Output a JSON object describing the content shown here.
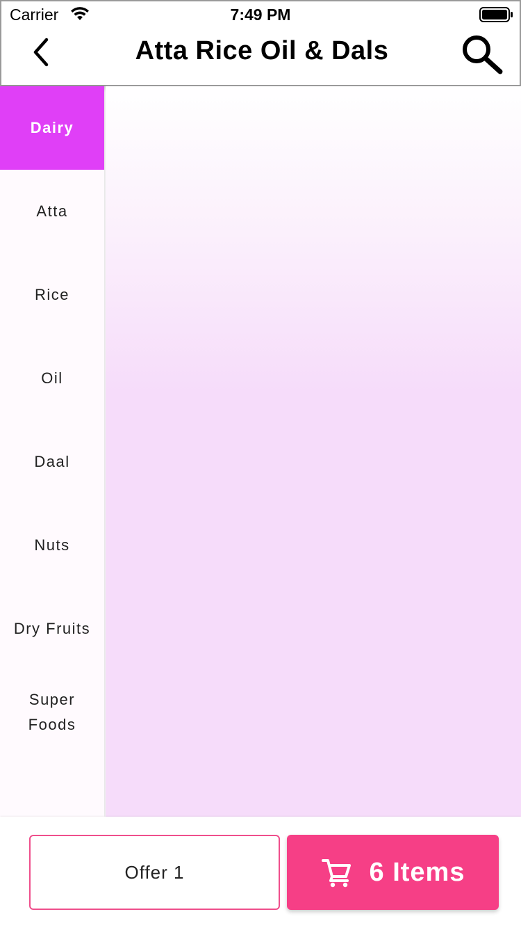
{
  "status_bar": {
    "carrier": "Carrier",
    "time": "7:49 PM",
    "icons": [
      "wifi-icon",
      "battery-icon"
    ]
  },
  "nav": {
    "title": "Atta Rice Oil & Dals",
    "back_icon": "chevron-left-icon",
    "search_icon": "search-icon"
  },
  "sidebar": {
    "active_color": "#e03ff7",
    "items": [
      {
        "label": "Dairy",
        "active": true
      },
      {
        "label": "Atta",
        "active": false
      },
      {
        "label": "Rice",
        "active": false
      },
      {
        "label": "Oil",
        "active": false
      },
      {
        "label": "Daal",
        "active": false
      },
      {
        "label": "Nuts",
        "active": false
      },
      {
        "label": "Dry Fruits",
        "active": false
      },
      {
        "label": "Super Foods",
        "active": false
      }
    ]
  },
  "bottom_bar": {
    "offer_label": "Offer 1",
    "cart_label": "6 Items",
    "cart_icon": "cart-icon",
    "cart_color": "#f63f86"
  }
}
